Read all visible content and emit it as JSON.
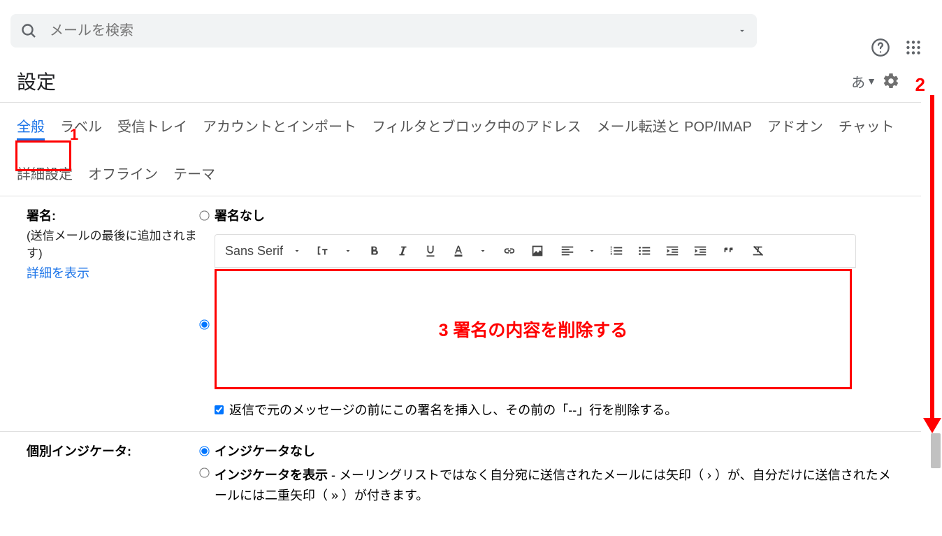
{
  "search": {
    "placeholder": "メールを検索"
  },
  "page": {
    "title": "設定",
    "lang_label": "あ"
  },
  "tabs": [
    "全般",
    "ラベル",
    "受信トレイ",
    "アカウントとインポート",
    "フィルタとブロック中のアドレス",
    "メール転送と POP/IMAP",
    "アドオン",
    "チャット",
    "詳細設定",
    "オフライン",
    "テーマ"
  ],
  "active_tab_index": 0,
  "signature": {
    "label": "署名:",
    "desc": "(送信メールの最後に追加されます)",
    "link": "詳細を表示",
    "option_none": "署名なし",
    "checkbox_text": "返信で元のメッセージの前にこの署名を挿入し、その前の「--」行を削除する。"
  },
  "toolbar": {
    "font_name": "Sans Serif"
  },
  "indicator": {
    "label": "個別インジケータ:",
    "option_none": "インジケータなし",
    "option_show_title": "インジケータを表示",
    "option_show_desc": " - メーリングリストではなく自分宛に送信されたメールには矢印（ › ）が、自分だけに送信されたメールには二重矢印（ » ）が付きます。"
  },
  "annotations": {
    "n1": "1",
    "n2": "2",
    "editor_text": "3 署名の内容を削除する"
  }
}
